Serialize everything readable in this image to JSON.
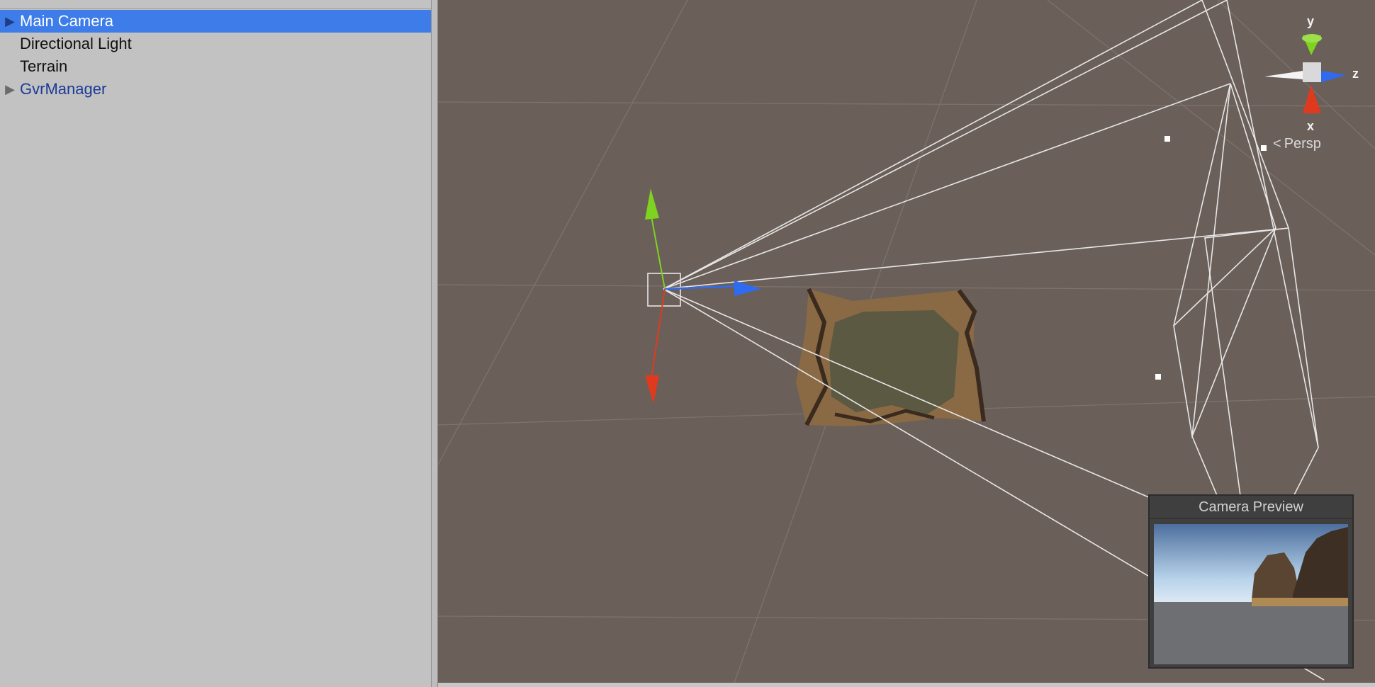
{
  "hierarchy": {
    "items": [
      {
        "label": "Main Camera",
        "selected": true,
        "expandable": true
      },
      {
        "label": "Directional Light",
        "selected": false,
        "expandable": false
      },
      {
        "label": "Terrain",
        "selected": false,
        "expandable": false
      },
      {
        "label": "GvrManager",
        "selected": false,
        "expandable": true
      }
    ]
  },
  "scene": {
    "gizmo": {
      "x_label": "x",
      "y_label": "y",
      "z_label": "z",
      "projection": "Persp"
    },
    "camera_preview": {
      "title": "Camera Preview"
    }
  },
  "colors": {
    "selection": "#3e7de9",
    "scene_bg": "#6b5f59",
    "x_axis": "#e03a1e",
    "y_axis": "#7ed321",
    "z_axis": "#2f6bf0"
  }
}
